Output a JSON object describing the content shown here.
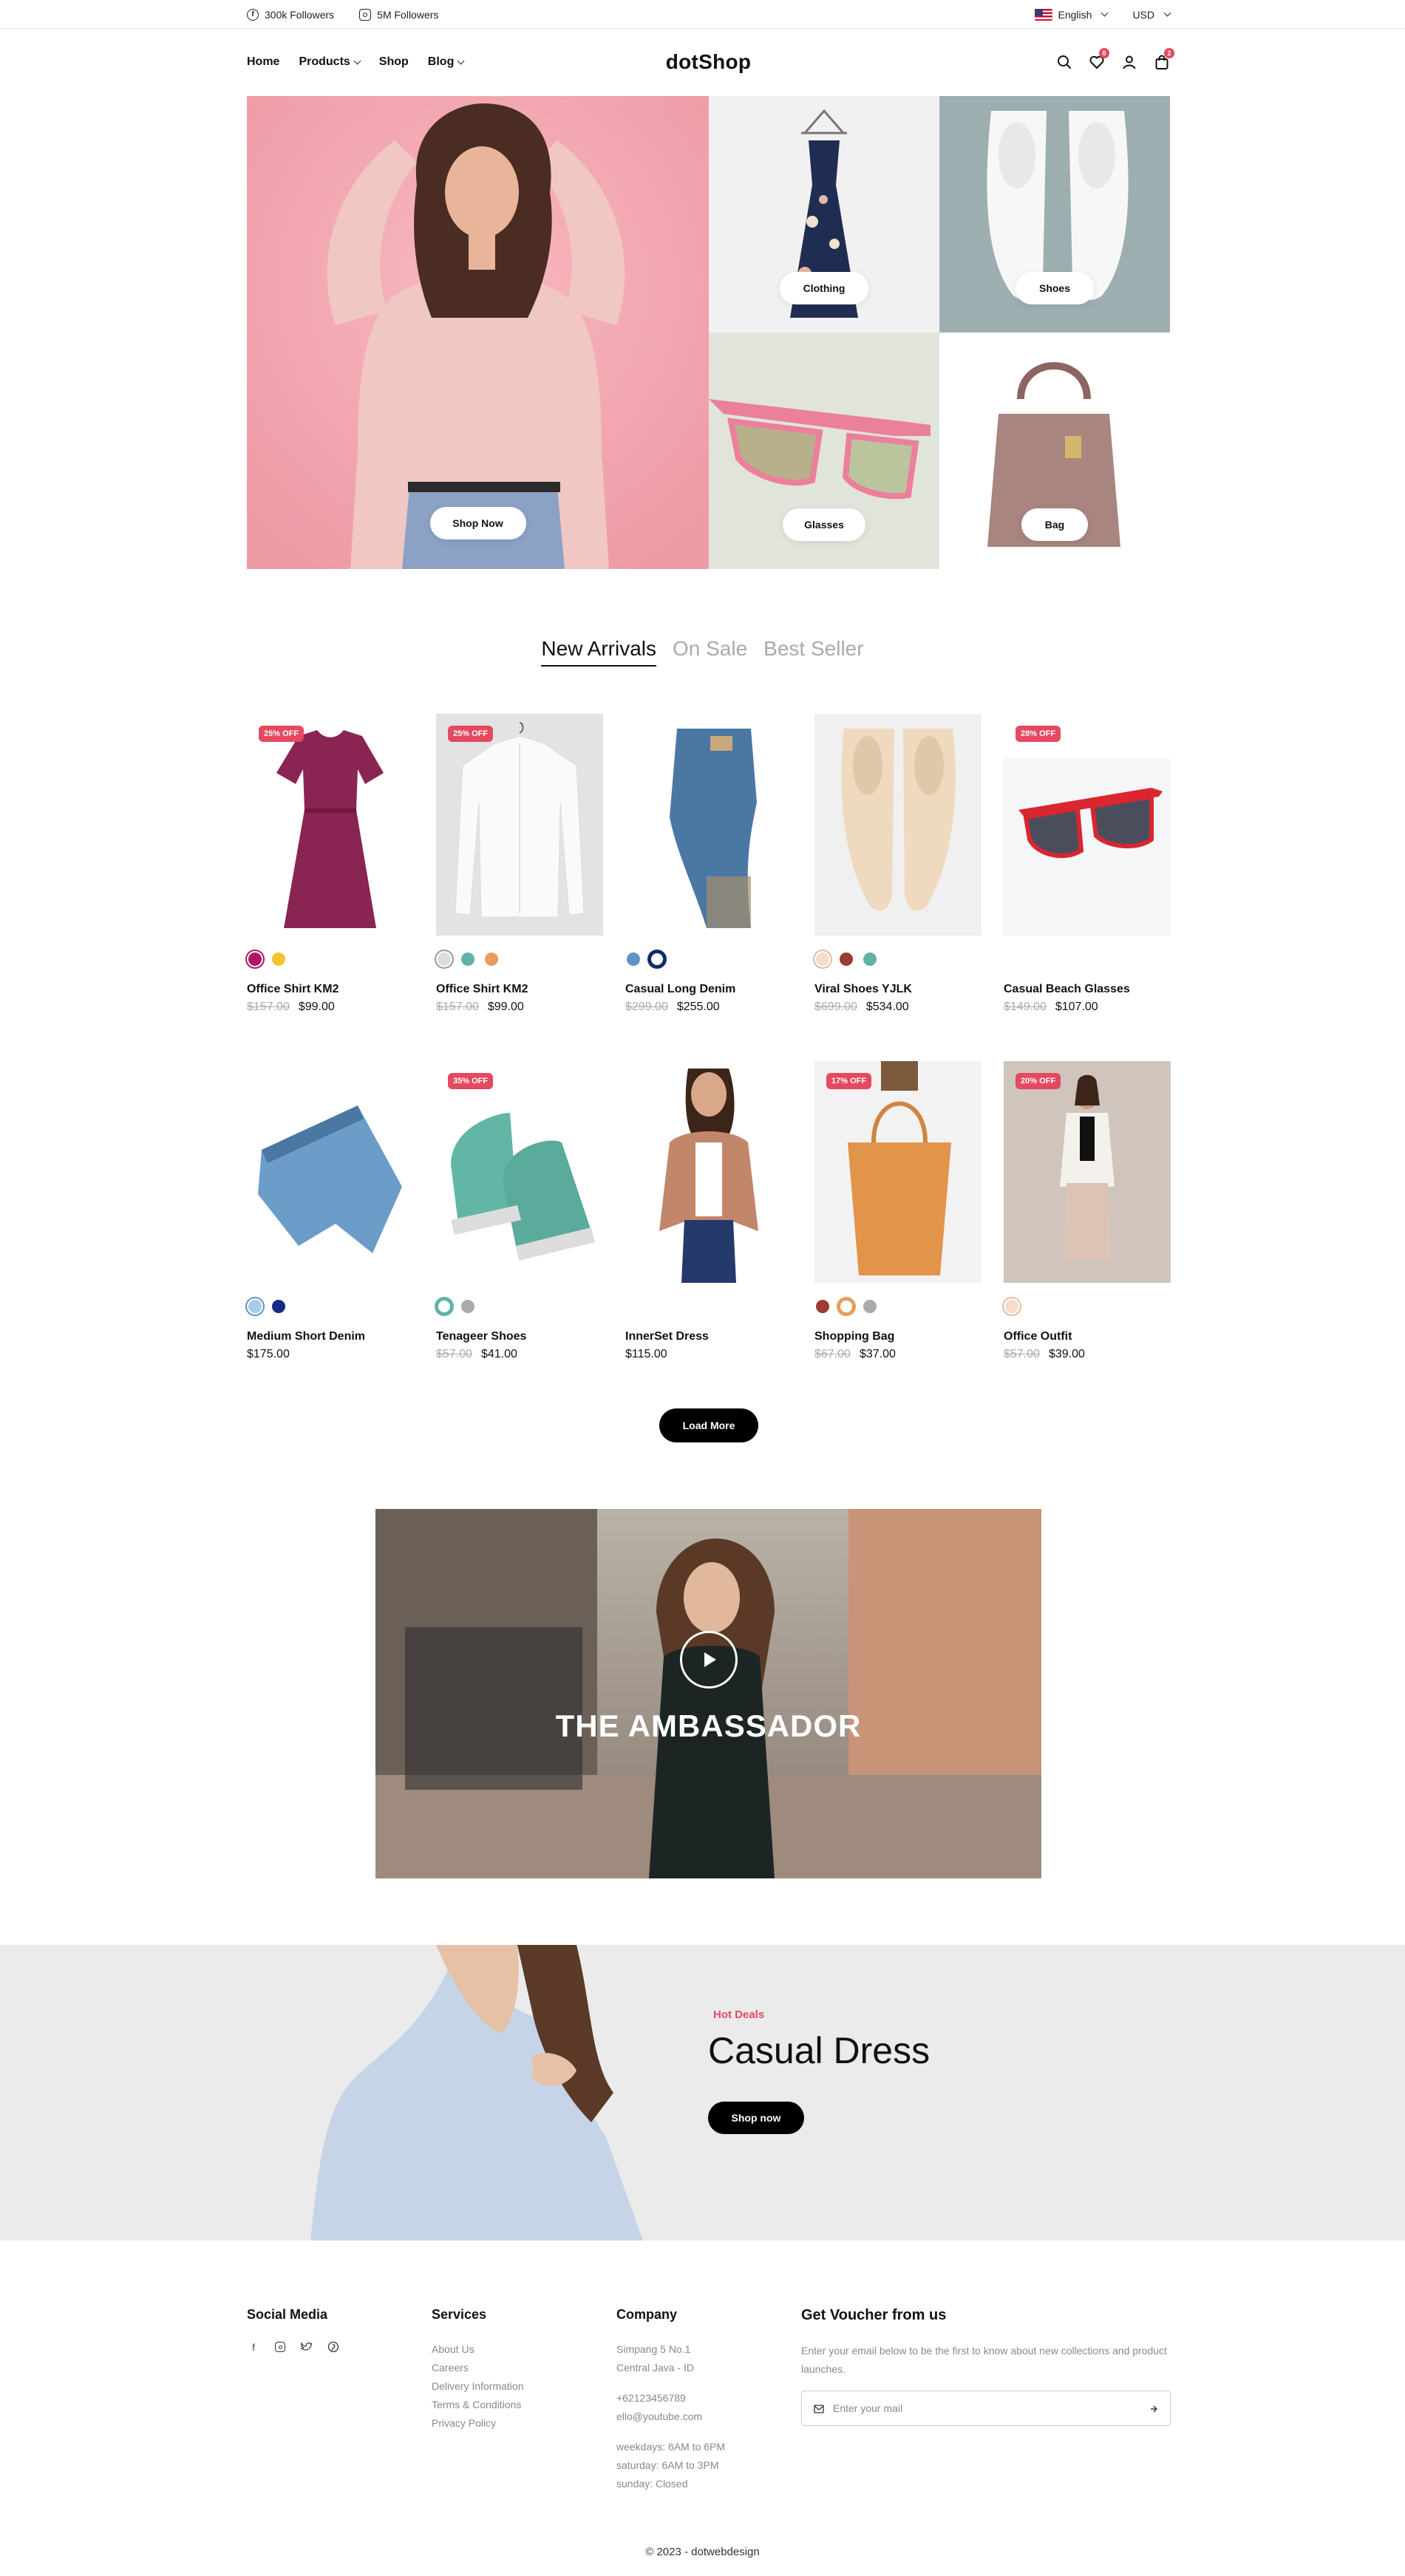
{
  "topbar": {
    "facebook": "300k Followers",
    "instagram": "5M Followers",
    "language": "English",
    "currency": "USD"
  },
  "nav": {
    "links": [
      "Home",
      "Products",
      "Shop",
      "Blog"
    ],
    "logo": "dotShop",
    "wishlist_count": "0",
    "cart_count": "2"
  },
  "hero": {
    "main_cta": "Shop Now",
    "categories": [
      "Clothing",
      "Shoes",
      "Glasses",
      "Bag"
    ]
  },
  "tabs": [
    "New Arrivals",
    "On Sale",
    "Best Seller"
  ],
  "products": [
    {
      "name": "Office Shirt KM2",
      "old": "$157.00",
      "price": "$99.00",
      "badge": "25% OFF",
      "swatches": [
        "#b0185f",
        "#f2c32e"
      ]
    },
    {
      "name": "Office Shirt KM2",
      "old": "$157.00",
      "price": "$99.00",
      "badge": "25% OFF",
      "swatches": [
        "#dcdcdc",
        "#5fb3a6",
        "#e99c5c"
      ]
    },
    {
      "name": "Casual Long Denim",
      "old": "$299.00",
      "price": "$255.00",
      "badge": "",
      "swatches": [
        "#5e94c6",
        "#0f2a6e"
      ]
    },
    {
      "name": "Viral Shoes YJLK",
      "old": "$699.00",
      "price": "$534.00",
      "badge": "",
      "swatches": [
        "#f7dcc9",
        "#9c3b31",
        "#5fb3a6"
      ]
    },
    {
      "name": "Casual Beach Glasses",
      "old": "$149.00",
      "price": "$107.00",
      "badge": "28% OFF",
      "swatches": []
    },
    {
      "name": "Medium Short Denim",
      "old": "",
      "price": "$175.00",
      "badge": "",
      "swatches": [
        "#a8cde8",
        "#112b86"
      ]
    },
    {
      "name": "Tenageer Shoes",
      "old": "$57.00",
      "price": "$41.00",
      "badge": "35% OFF",
      "swatches": [
        "#5fb3a6",
        "#aaaaaa"
      ]
    },
    {
      "name": "InnerSet Dress",
      "old": "",
      "price": "$115.00",
      "badge": "",
      "swatches": []
    },
    {
      "name": "Shopping Bag",
      "old": "$67.00",
      "price": "$37.00",
      "badge": "17% OFF",
      "swatches": [
        "#9c3b31",
        "#e99c5c",
        "#aaaaaa"
      ]
    },
    {
      "name": "Office Outfit",
      "old": "$57.00",
      "price": "$39.00",
      "badge": "20% OFF",
      "swatches": [
        "#f7dcc9"
      ]
    }
  ],
  "load_more": "Load More",
  "ambassador": {
    "title": "THE AMBASSADOR"
  },
  "deal": {
    "tag": "Hot Deals",
    "title": "Casual Dress",
    "cta": "Shop now"
  },
  "footer": {
    "social_title": "Social Media",
    "services_title": "Services",
    "services": [
      "About Us",
      "Careers",
      "Delivery Information",
      "Terms & Conditions",
      "Privacy Policy"
    ],
    "company_title": "Company",
    "address": [
      "Simpang 5 No.1",
      "Central Java - ID"
    ],
    "contact": [
      "+62123456789",
      "ello@youtube.com"
    ],
    "hours": [
      "weekdays: 6AM to 6PM",
      "saturday: 6AM to 3PM",
      "sunday: Closed"
    ],
    "voucher_title": "Get Voucher from us",
    "voucher_text": "Enter your email below to be the first to know about new collections and product launches.",
    "email_placeholder": "Enter your mail",
    "copyright": "© 2023 - dotwebdesign"
  }
}
